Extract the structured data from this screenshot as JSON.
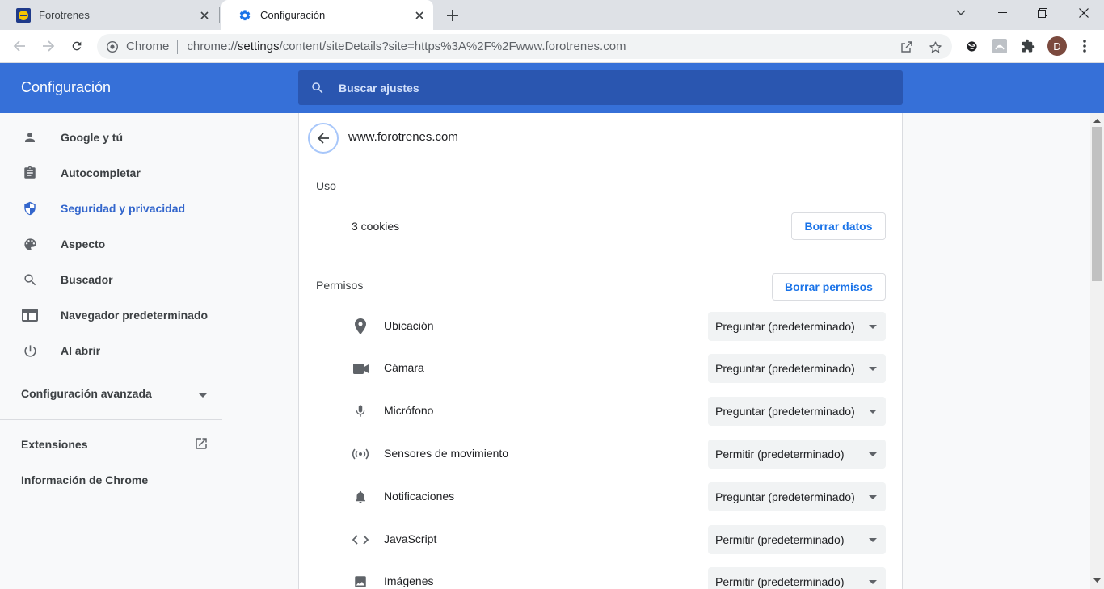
{
  "browser": {
    "tabs": [
      {
        "title": "Forotrenes",
        "icon": "forotrenes-favicon"
      },
      {
        "title": "Configuración",
        "icon": "gear-icon"
      }
    ],
    "omnibox": {
      "chip": "Chrome",
      "url_prefix": "chrome://",
      "url_host": "settings",
      "url_rest": "/content/siteDetails?site=https%3A%2F%2Fwww.forotrenes.com"
    },
    "profile_initial": "D"
  },
  "header": {
    "title": "Configuración",
    "search_placeholder": "Buscar ajustes"
  },
  "sidebar": {
    "items": [
      {
        "label": "Google y tú",
        "icon": "person-icon"
      },
      {
        "label": "Autocompletar",
        "icon": "clipboard-icon"
      },
      {
        "label": "Seguridad y privacidad",
        "icon": "shield-icon",
        "active": true
      },
      {
        "label": "Aspecto",
        "icon": "palette-icon"
      },
      {
        "label": "Buscador",
        "icon": "search-icon"
      },
      {
        "label": "Navegador predeterminado",
        "icon": "browser-icon"
      },
      {
        "label": "Al abrir",
        "icon": "power-icon"
      }
    ],
    "advanced_label": "Configuración avanzada",
    "extensions_label": "Extensiones",
    "about_label": "Información de Chrome"
  },
  "site": {
    "name": "www.forotrenes.com",
    "usage_label": "Uso",
    "cookies": "3 cookies",
    "clear_data_label": "Borrar datos",
    "permissions_label": "Permisos",
    "reset_permissions_label": "Borrar permisos",
    "permissions": [
      {
        "label": "Ubicación",
        "value": "Preguntar (predeterminado)",
        "icon": "location-icon"
      },
      {
        "label": "Cámara",
        "value": "Preguntar (predeterminado)",
        "icon": "camera-icon"
      },
      {
        "label": "Micrófono",
        "value": "Preguntar (predeterminado)",
        "icon": "microphone-icon"
      },
      {
        "label": "Sensores de movimiento",
        "value": "Permitir (predeterminado)",
        "icon": "sensors-icon"
      },
      {
        "label": "Notificaciones",
        "value": "Preguntar (predeterminado)",
        "icon": "bell-icon"
      },
      {
        "label": "JavaScript",
        "value": "Permitir (predeterminado)",
        "icon": "code-icon"
      },
      {
        "label": "Imágenes",
        "value": "Permitir (predeterminado)",
        "icon": "image-icon"
      }
    ]
  },
  "colors": {
    "header_blue": "#3670d8",
    "search_blue": "#2a56b0",
    "accent_blue": "#1a73e8",
    "active_nav": "#3366cc"
  }
}
